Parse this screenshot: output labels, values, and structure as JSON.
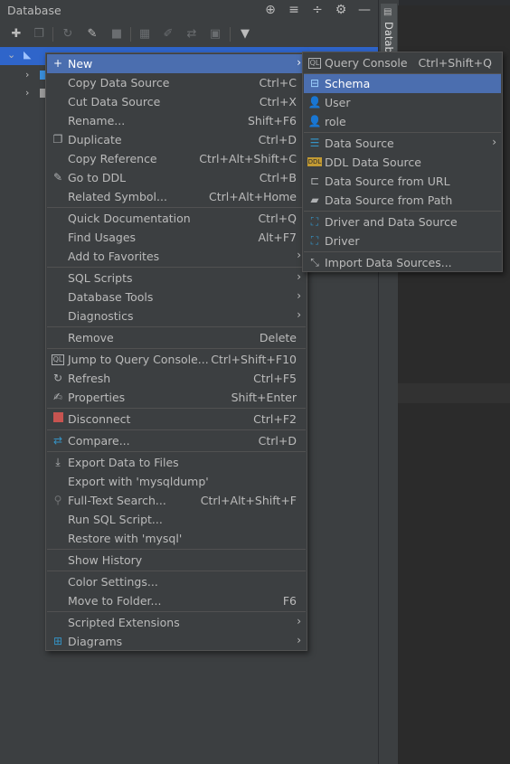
{
  "panel": {
    "title": "Database",
    "side_tab_label": "Datab"
  },
  "context_menu": {
    "items": [
      {
        "label": "New",
        "shortcut": "",
        "icon": "plus-icon",
        "submenu": true
      },
      {
        "label": "Copy Data Source",
        "shortcut": "Ctrl+C"
      },
      {
        "label": "Cut Data Source",
        "shortcut": "Ctrl+X"
      },
      {
        "label": "Rename...",
        "shortcut": "Shift+F6"
      },
      {
        "label": "Duplicate",
        "shortcut": "Ctrl+D",
        "icon": "duplicate-icon"
      },
      {
        "label": "Copy Reference",
        "shortcut": "Ctrl+Alt+Shift+C"
      },
      {
        "label": "Go to DDL",
        "shortcut": "Ctrl+B",
        "icon": "pencil-icon"
      },
      {
        "label": "Related Symbol...",
        "shortcut": "Ctrl+Alt+Home"
      },
      {
        "label": "Quick Documentation",
        "shortcut": "Ctrl+Q"
      },
      {
        "label": "Find Usages",
        "shortcut": "Alt+F7"
      },
      {
        "label": "Add to Favorites",
        "shortcut": "",
        "submenu": true
      },
      {
        "label": "SQL Scripts",
        "shortcut": "",
        "submenu": true
      },
      {
        "label": "Database Tools",
        "shortcut": "",
        "submenu": true
      },
      {
        "label": "Diagnostics",
        "shortcut": "",
        "submenu": true
      },
      {
        "label": "Remove",
        "shortcut": "Delete"
      },
      {
        "label": "Jump to Query Console...",
        "shortcut": "Ctrl+Shift+F10",
        "icon": "query-console-icon"
      },
      {
        "label": "Refresh",
        "shortcut": "Ctrl+F5",
        "icon": "refresh-icon"
      },
      {
        "label": "Properties",
        "shortcut": "Shift+Enter",
        "icon": "properties-icon"
      },
      {
        "label": "Disconnect",
        "shortcut": "Ctrl+F2",
        "icon": "stop-icon"
      },
      {
        "label": "Compare...",
        "shortcut": "Ctrl+D",
        "icon": "compare-icon"
      },
      {
        "label": "Export Data to Files",
        "shortcut": "",
        "icon": "export-icon"
      },
      {
        "label": "Export with 'mysqldump'",
        "shortcut": ""
      },
      {
        "label": "Full-Text Search...",
        "shortcut": "Ctrl+Alt+Shift+F",
        "icon": "search-icon"
      },
      {
        "label": "Run SQL Script...",
        "shortcut": ""
      },
      {
        "label": "Restore with 'mysql'",
        "shortcut": ""
      },
      {
        "label": "Show History",
        "shortcut": ""
      },
      {
        "label": "Color Settings...",
        "shortcut": ""
      },
      {
        "label": "Move to Folder...",
        "shortcut": "F6"
      },
      {
        "label": "Scripted Extensions",
        "shortcut": "",
        "submenu": true
      },
      {
        "label": "Diagrams",
        "shortcut": "",
        "icon": "diagram-icon",
        "submenu": true
      }
    ]
  },
  "new_submenu": {
    "items": [
      {
        "label": "Query Console",
        "shortcut": "Ctrl+Shift+Q",
        "icon": "query-console-icon"
      },
      {
        "label": "Schema",
        "shortcut": "",
        "icon": "schema-icon"
      },
      {
        "label": "User",
        "shortcut": "",
        "icon": "user-icon"
      },
      {
        "label": "role",
        "shortcut": "",
        "icon": "role-icon"
      },
      {
        "label": "Data Source",
        "shortcut": "",
        "icon": "datasource-icon",
        "submenu": true
      },
      {
        "label": "DDL Data Source",
        "shortcut": "",
        "icon": "ddl-icon"
      },
      {
        "label": "Data Source from URL",
        "shortcut": "",
        "icon": "url-icon"
      },
      {
        "label": "Data Source from Path",
        "shortcut": "",
        "icon": "folder-icon"
      },
      {
        "label": "Driver and Data Source",
        "shortcut": "",
        "icon": "driver-icon"
      },
      {
        "label": "Driver",
        "shortcut": "",
        "icon": "driver-icon"
      },
      {
        "label": "Import Data Sources...",
        "shortcut": "",
        "icon": "import-icon"
      }
    ]
  },
  "colors": {
    "highlight": "#4b6eaf",
    "selection": "#2f65ca",
    "background": "#3c3f41"
  }
}
